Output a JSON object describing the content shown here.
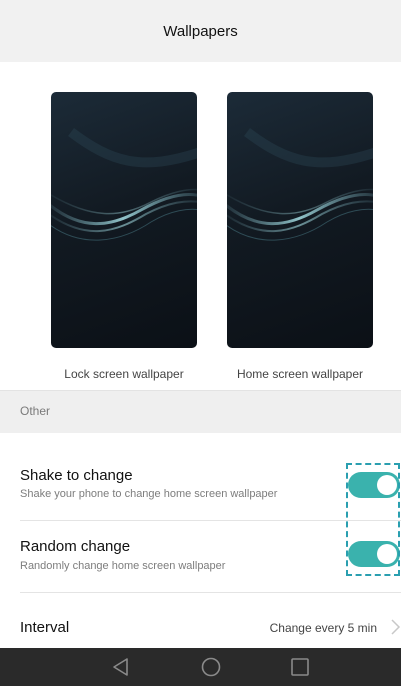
{
  "header": {
    "title": "Wallpapers"
  },
  "wallpapers": [
    {
      "caption": "Lock screen wallpaper"
    },
    {
      "caption": "Home screen wallpaper"
    }
  ],
  "section": {
    "label": "Other"
  },
  "settings": {
    "shake": {
      "title": "Shake to change",
      "subtitle": "Shake your phone to change home screen wallpaper",
      "enabled": true
    },
    "random": {
      "title": "Random change",
      "subtitle": "Randomly change home screen wallpaper",
      "enabled": true
    },
    "interval": {
      "title": "Interval",
      "value": "Change every 5 min"
    }
  },
  "icons": {
    "back": "triangle-back-icon",
    "home": "circle-home-icon",
    "recent": "square-recent-icon",
    "chevron": "chevron-right-icon"
  },
  "colors": {
    "toggle_on": "#3ab2ad",
    "highlight": "#2a9fb0",
    "navbar": "#2a2a2a"
  }
}
